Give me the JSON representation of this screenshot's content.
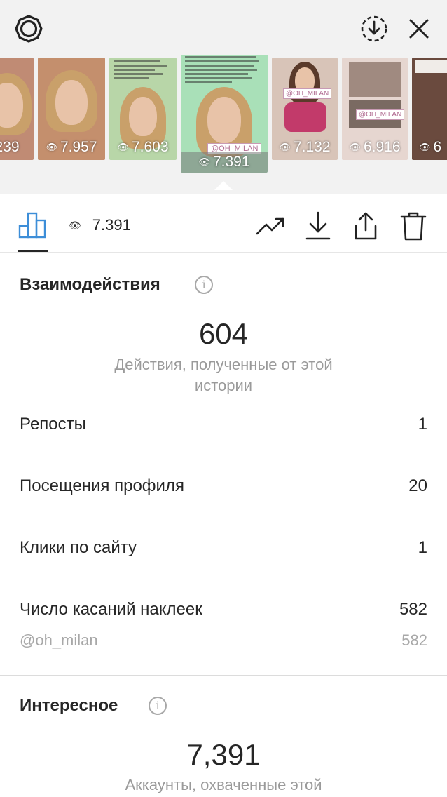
{
  "thumbnails": [
    {
      "views": "239",
      "bg": "#c08b74"
    },
    {
      "views": "7.957",
      "bg": "#c48f6d"
    },
    {
      "views": "7.603",
      "bg": "#b8d6a8"
    },
    {
      "views": "7.391",
      "bg": "#a9e0b8",
      "current": true,
      "tag": "@OH_MILAN"
    },
    {
      "views": "7.132",
      "bg": "#d8c4b8",
      "tag": "@OH_MILAN"
    },
    {
      "views": "6.916",
      "bg": "#e6d6d0",
      "tag": "@OH_MILAN"
    },
    {
      "views": "6",
      "bg": "#6a4a3e"
    }
  ],
  "toolbar": {
    "views": "7.391"
  },
  "interactions": {
    "title": "Взаимодействия",
    "total": "604",
    "total_label": "Действия, полученные от этой истории",
    "rows": [
      {
        "label": "Репосты",
        "value": "1"
      },
      {
        "label": "Посещения профиля",
        "value": "20"
      },
      {
        "label": "Клики по сайту",
        "value": "1"
      },
      {
        "label": "Число касаний наклеек",
        "value": "582"
      }
    ],
    "sub_row": {
      "label": "@oh_milan",
      "value": "582"
    }
  },
  "discovery": {
    "title": "Интересное",
    "total": "7,391",
    "total_label": "Аккаунты, охваченные этой"
  },
  "icons": {
    "settings": "settings-gear-icon",
    "download_circle": "download-circle-icon",
    "close": "close-icon",
    "insights": "bar-chart-icon",
    "eye": "eye-icon",
    "promote": "trending-up-icon",
    "download": "download-icon",
    "share": "share-icon",
    "delete": "trash-icon"
  }
}
